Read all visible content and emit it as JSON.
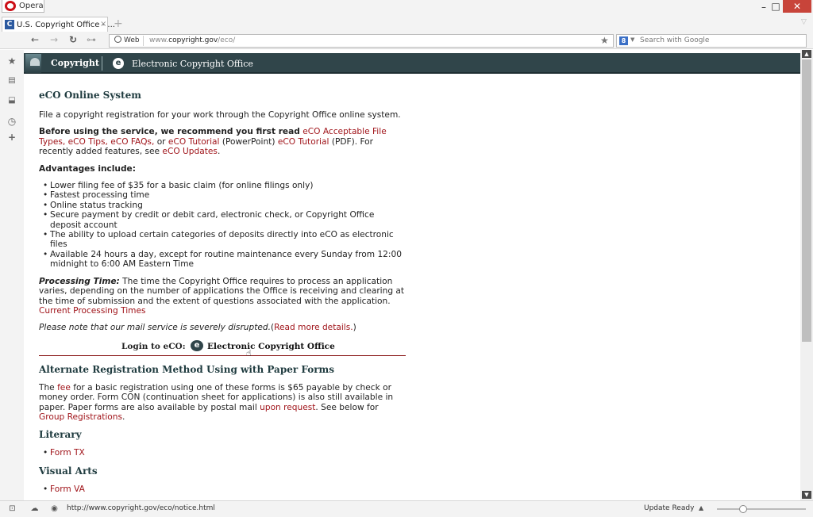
{
  "browser": {
    "menu_label": "Opera",
    "window_controls": {
      "minimize": "–",
      "maximize": "□",
      "close": "✕"
    },
    "tab": {
      "title": "U.S. Copyright Office - ...",
      "close": "×",
      "favicon_letter": "C"
    },
    "new_tab": "+",
    "address": {
      "badge": "Web",
      "url_prefix": "www.",
      "url_domain": "copyright.gov",
      "url_path": "/eco/"
    },
    "search_placeholder": "Search with Google",
    "search_engine_letter": "8",
    "status_url": "http://www.copyright.gov/eco/notice.html",
    "status_ready": "Update Ready"
  },
  "site_header": {
    "brand": "Copyright",
    "eco_letter": "e",
    "eco_title": "Electronic Copyright Office"
  },
  "content": {
    "heading": "eCO Online System",
    "intro": "File a copyright registration for your work through the Copyright Office online system.",
    "before_bold": "Before using the service, we recommend you first read",
    "links_1": {
      "file_types": "eCO Acceptable File Types,",
      "tips": "eCO Tips,",
      "faqs": "eCO FAQs,",
      "or": "or",
      "tutorial_ppt": "eCO Tutorial",
      "ppt_note": "(PowerPoint)",
      "tutorial_pdf": "eCO Tutorial",
      "pdf_note": "(PDF). For recently added features, see",
      "updates": "eCO Updates",
      "period": "."
    },
    "advantages_heading": "Advantages include:",
    "advantages": [
      "Lower filing fee of $35 for a basic claim (for online filings only)",
      "Fastest processing time",
      "Online status tracking",
      "Secure payment by credit or debit card, electronic check, or Copyright Office deposit account",
      "The ability to upload certain categories of deposits directly into eCO as electronic files",
      "Available 24 hours a day, except for routine maintenance every Sunday from 12:00 midnight to 6:00 AM Eastern Time"
    ],
    "processing_label": "Processing Time:",
    "processing_text": "The time the Copyright Office requires to process an application varies, depending on the number of applications the Office is receiving and clearing at the time of submission and the extent of questions associated with the application.",
    "processing_link": "Current Processing Times",
    "mail_note": "Please note that our mail service is severely disrupted.",
    "mail_link_open": "(",
    "mail_link": "Read more details.",
    "mail_link_close": ")",
    "login_label": "Login to eCO:",
    "login_link": "Electronic Copyright Office",
    "alt_heading": "Alternate Registration Method Using with Paper Forms",
    "alt_p_1": "The",
    "alt_fee_link": "fee",
    "alt_p_2": "for a basic registration using one of these forms is $65 payable by check or money order. Form CON (continuation sheet for applications) is also still available in paper. Paper forms are also available by postal mail",
    "alt_request_link": "upon request",
    "alt_p_3": ". See below for",
    "alt_group_link": "Group Registrations",
    "alt_p_4": ".",
    "literary_heading": "Literary",
    "literary_items": [
      "Form TX"
    ],
    "visual_heading": "Visual Arts",
    "visual_items": [
      "Form VA"
    ]
  }
}
